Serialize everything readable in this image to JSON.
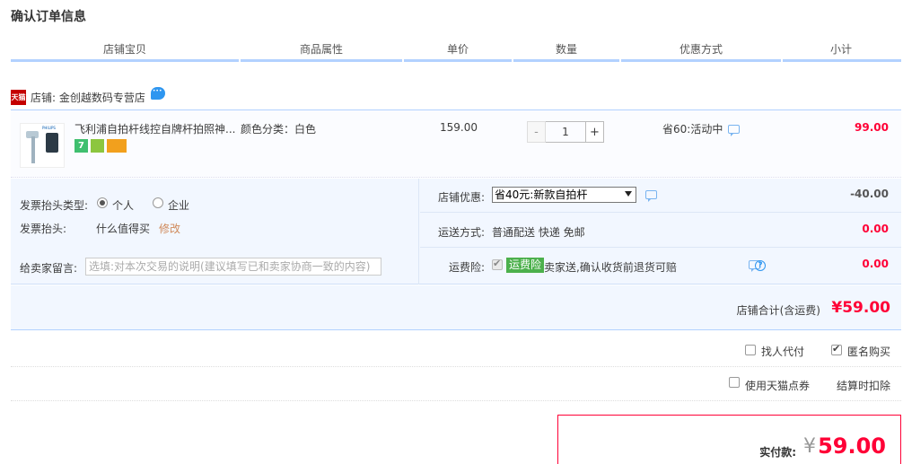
{
  "page_title": "确认订单信息",
  "columns": [
    "店铺宝贝",
    "商品属性",
    "单价",
    "数量",
    "优惠方式",
    "小计"
  ],
  "shop": {
    "tmall_badge": "天猫",
    "label": "店铺: 金创越数码专营店"
  },
  "item": {
    "thumb_brand": "PHILIPS",
    "name": "飞利浦自拍杆线控自牌杆拍照神...",
    "attribute": "颜色分类：白色",
    "unit_price": "159.00",
    "quantity": "1",
    "minus": "-",
    "plus": "+",
    "promo": "省60:活动中",
    "subtotal": "99.00",
    "badges": [
      "7",
      "",
      ""
    ]
  },
  "invoice": {
    "type_label": "发票抬头类型:",
    "option_personal": "个人",
    "option_company": "企业",
    "head_label": "发票抬头:",
    "head_value": "什么值得买",
    "edit_link": "修改"
  },
  "message": {
    "label": "给卖家留言:",
    "placeholder": "选填:对本次交易的说明(建议填写已和卖家协商一致的内容)"
  },
  "shop_discount": {
    "label": "店铺优惠:",
    "selected": "省40元:新款自拍杆",
    "amount": "-40.00"
  },
  "shipping": {
    "label": "运送方式:",
    "value": "普通配送 快递 免邮",
    "amount": "0.00"
  },
  "insurance": {
    "label": "运费险:",
    "tag": "运费险",
    "desc": "卖家送,确认收货前退货可赔",
    "amount": "0.00"
  },
  "shop_total": {
    "label": "店铺合计(含运费)",
    "amount": "¥59.00"
  },
  "options": {
    "proxy_pay": "找人代付",
    "anonymous": "匿名购买",
    "tmall_points": "使用天猫点券",
    "deduct_note": "结算时扣除"
  },
  "payment": {
    "label": "实付款:",
    "currency": "¥",
    "amount": "59.00"
  }
}
